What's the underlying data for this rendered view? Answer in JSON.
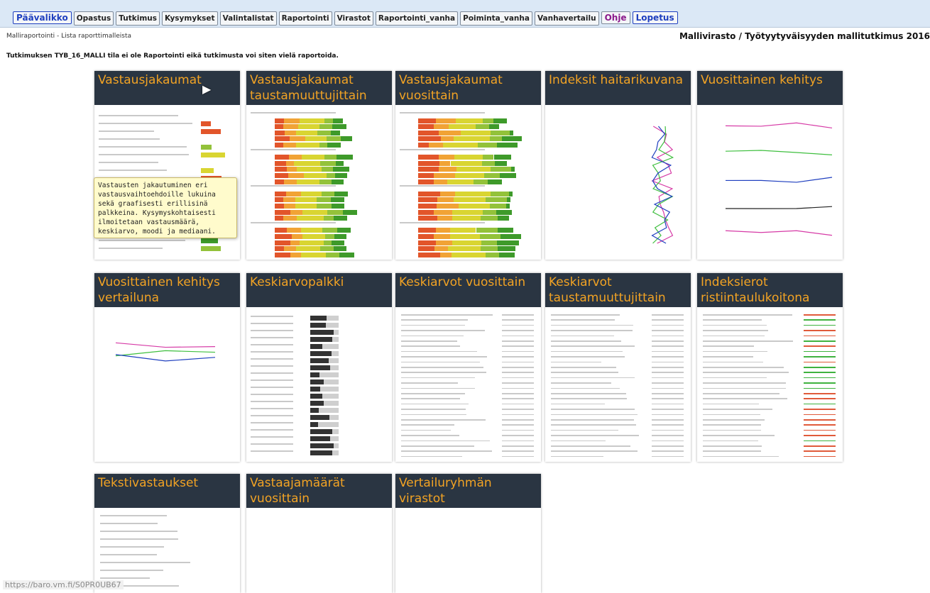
{
  "nav": {
    "items": [
      {
        "name": "nav-paavalikko",
        "label": "Päävalikko",
        "style": "primary"
      },
      {
        "name": "nav-opastus",
        "label": "Opastus",
        "style": "normal"
      },
      {
        "name": "nav-tutkimus",
        "label": "Tutkimus",
        "style": "normal"
      },
      {
        "name": "nav-kysymykset",
        "label": "Kysymykset",
        "style": "normal"
      },
      {
        "name": "nav-valintalistat",
        "label": "Valintalistat",
        "style": "normal"
      },
      {
        "name": "nav-raportointi",
        "label": "Raportointi",
        "style": "normal"
      },
      {
        "name": "nav-virastot",
        "label": "Virastot",
        "style": "normal"
      },
      {
        "name": "nav-raportointi-vanha",
        "label": "Raportointi_vanha",
        "style": "normal"
      },
      {
        "name": "nav-poiminta-vanha",
        "label": "Poiminta_vanha",
        "style": "normal"
      },
      {
        "name": "nav-vanhavertailu",
        "label": "Vanhavertailu",
        "style": "normal"
      },
      {
        "name": "nav-ohje",
        "label": "Ohje",
        "style": "help"
      },
      {
        "name": "nav-lopetus",
        "label": "Lopetus",
        "style": "logout"
      }
    ]
  },
  "header": {
    "breadcrumb": "Malliraportointi - Lista raporttimalleista",
    "organization": "Mallivirasto / Työtyytyväisyyden mallitutkimus 2016"
  },
  "notice": "Tutkimuksen TYB_16_MALLI tila ei ole Raportointi eikä tutkimusta voi siten vielä raportoida.",
  "cards": [
    {
      "title": "Vastausjakaumat",
      "thumb": "text-bars"
    },
    {
      "title": "Vastausjakaumat taustamuuttujittain",
      "thumb": "stacked"
    },
    {
      "title": "Vastausjakaumat vuosittain",
      "thumb": "stacked-wide"
    },
    {
      "title": "Indeksit haitarikuvana",
      "thumb": "lines-vertical"
    },
    {
      "title": "Vuosittainen kehitys",
      "thumb": "trend-lines"
    },
    {
      "title": "Vuosittainen kehitys vertailuna",
      "thumb": "line-chart"
    },
    {
      "title": "Keskiarvopalkki",
      "thumb": "mean-bars"
    },
    {
      "title": "Keskiarvot vuosittain",
      "thumb": "table"
    },
    {
      "title": "Keskiarvot taustamuuttujittain",
      "thumb": "table"
    },
    {
      "title": "Indeksierot ristiintaulukoitona",
      "thumb": "table-colored"
    },
    {
      "title": "Tekstivastaukset",
      "thumb": "text-list"
    },
    {
      "title": "Vastaajamäärät vuosittain",
      "thumb": "blank"
    },
    {
      "title": "Vertailuryhmän virastot",
      "thumb": "blank"
    }
  ],
  "tooltip": "Vastausten jakautuminen eri vastausvaihtoehdoille lukuina sekä graafisesti erillisinä palkkeina. Kysymyskohtaisesti ilmoitetaan vastausmäärä, keskiarvo, moodi ja mediaani.",
  "status_url": "https://baro.vm.fi/S0PR0UB67",
  "colors": {
    "card_header_bg": "#2a3542",
    "card_title": "#f2a324",
    "scale": [
      "#e2552a",
      "#f1a335",
      "#d9d532",
      "#93c23a",
      "#3e9a2a"
    ]
  }
}
